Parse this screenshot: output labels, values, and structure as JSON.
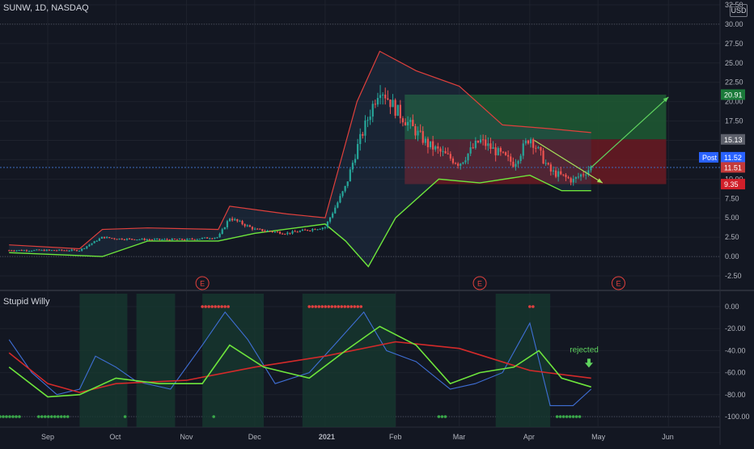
{
  "header": {
    "symbol_line": "SUNW, 1D, NASDAQ",
    "currency": "USD",
    "indicator_title": "Stupid Willy"
  },
  "colors": {
    "background": "#131722",
    "up_candle": "#26a69a",
    "down_candle": "#ef5350",
    "upper_band": "#e0403c",
    "lower_band": "#6ee63c",
    "profit_zone": "#1e5a32",
    "loss_zone": "#6b1a22",
    "projection_arrow": "#5fd35f",
    "indicator_blue": "#3f6fd6",
    "indicator_red": "#d42a2a",
    "indicator_green": "#6ee63c",
    "highlight_teal": "#16382f"
  },
  "price_labels": {
    "target": "20.91",
    "entry": "15.13",
    "post_label": "Post",
    "post_price": "11.52",
    "last_price": "11.51",
    "stop": "9.35"
  },
  "annotation": {
    "rejected": "rejected",
    "earnings_marker": "E"
  },
  "chart_data": [
    {
      "type": "candlestick",
      "title": "SUNW, 1D, NASDAQ",
      "y_ticks": [
        "32.50",
        "30.00",
        "27.50",
        "25.00",
        "22.50",
        "20.00",
        "17.50",
        "15.00",
        "12.50",
        "10.00",
        "7.50",
        "5.00",
        "2.50",
        "0.00",
        "-2.50"
      ],
      "ylim": [
        -3.5,
        32.5
      ],
      "x_ticks": [
        "Sep",
        "Oct",
        "Nov",
        "Dec",
        "2021",
        "Feb",
        "Mar",
        "Apr",
        "May",
        "Jun"
      ],
      "price_path": {
        "x": [
          "2020-08-15",
          "2020-09-01",
          "2020-09-15",
          "2020-09-25",
          "2020-10-01",
          "2020-10-15",
          "2020-11-01",
          "2020-11-15",
          "2020-11-20",
          "2020-12-01",
          "2020-12-15",
          "2021-01-01",
          "2021-01-10",
          "2021-01-15",
          "2021-01-25",
          "2021-02-01",
          "2021-02-15",
          "2021-03-01",
          "2021-03-10",
          "2021-03-25",
          "2021-04-01",
          "2021-04-10",
          "2021-04-20",
          "2021-04-28"
        ],
        "y": [
          0.8,
          0.8,
          0.8,
          2.5,
          2.3,
          2.2,
          2.2,
          2.5,
          5.0,
          3.5,
          3.0,
          3.8,
          9.0,
          14.0,
          22.0,
          19.0,
          14.5,
          12.0,
          15.0,
          12.0,
          15.5,
          11.0,
          9.8,
          11.5
        ]
      },
      "upper_band": {
        "x": [
          "2020-08-15",
          "2020-09-15",
          "2020-09-25",
          "2020-10-15",
          "2020-11-15",
          "2020-11-20",
          "2020-12-15",
          "2021-01-01",
          "2021-01-15",
          "2021-01-25",
          "2021-02-10",
          "2021-03-01",
          "2021-03-20",
          "2021-04-10",
          "2021-04-28"
        ],
        "y": [
          1.5,
          1.0,
          3.5,
          3.7,
          3.5,
          6.5,
          5.5,
          5.0,
          20.0,
          26.5,
          24.0,
          22.0,
          17.0,
          16.5,
          16.0
        ]
      },
      "lower_band": {
        "x": [
          "2020-08-15",
          "2020-09-25",
          "2020-10-15",
          "2020-11-15",
          "2020-12-01",
          "2021-01-01",
          "2021-01-10",
          "2021-01-20",
          "2021-02-01",
          "2021-02-20",
          "2021-03-10",
          "2021-04-01",
          "2021-04-15",
          "2021-04-28"
        ],
        "y": [
          0.5,
          0.0,
          2.0,
          2.0,
          3.0,
          4.2,
          2.0,
          -1.3,
          5.0,
          10.0,
          9.5,
          10.5,
          8.5,
          8.5
        ]
      },
      "trade_zones": {
        "profit": {
          "from": "2021-02-05",
          "to": "2021-05-31",
          "low": 15.13,
          "high": 20.91
        },
        "loss": {
          "from": "2021-02-05",
          "to": "2021-05-31",
          "low": 9.35,
          "high": 15.13
        }
      },
      "earnings_dates": [
        "2020-11-08",
        "2021-03-10",
        "2021-05-10"
      ]
    },
    {
      "type": "line",
      "title": "Stupid Willy",
      "y_ticks": [
        "0.00",
        "-20.00",
        "-40.00",
        "-60.00",
        "-80.00",
        "-100.00"
      ],
      "ylim": [
        -105,
        5
      ],
      "x_ticks": [
        "Sep",
        "Oct",
        "Nov",
        "Dec",
        "2021",
        "Feb",
        "Mar",
        "Apr",
        "May",
        "Jun"
      ],
      "series": [
        {
          "x": [
            "2020-08-15",
            "2020-08-25",
            "2020-09-05",
            "2020-09-15",
            "2020-09-22",
            "2020-10-01",
            "2020-10-10",
            "2020-10-25",
            "2020-11-08",
            "2020-11-18",
            "2020-11-28",
            "2020-12-10",
            "2020-12-25",
            "2021-01-05",
            "2021-01-18",
            "2021-01-28",
            "2021-02-10",
            "2021-02-25",
            "2021-03-08",
            "2021-03-20",
            "2021-04-01",
            "2021-04-10",
            "2021-04-20",
            "2021-04-28"
          ],
          "y": [
            -30,
            -60,
            -80,
            -75,
            -45,
            -55,
            -68,
            -75,
            -35,
            -5,
            -30,
            -70,
            -60,
            -35,
            -5,
            -40,
            -50,
            -75,
            -70,
            -60,
            -15,
            -90,
            -90,
            -75
          ]
        },
        {
          "x": [
            "2020-08-15",
            "2020-09-01",
            "2020-09-15",
            "2020-10-01",
            "2020-11-01",
            "2020-12-01",
            "2021-01-01",
            "2021-02-01",
            "2021-03-01",
            "2021-04-01",
            "2021-04-28"
          ],
          "y": [
            -42,
            -70,
            -78,
            -70,
            -67,
            -55,
            -45,
            -32,
            -38,
            -58,
            -65
          ]
        },
        {
          "x": [
            "2020-08-15",
            "2020-09-01",
            "2020-09-15",
            "2020-10-01",
            "2020-10-20",
            "2020-11-08",
            "2020-11-20",
            "2020-12-05",
            "2020-12-25",
            "2021-01-10",
            "2021-01-25",
            "2021-02-10",
            "2021-02-25",
            "2021-03-10",
            "2021-03-25",
            "2021-04-05",
            "2021-04-15",
            "2021-04-28"
          ],
          "y": [
            -55,
            -82,
            -80,
            -65,
            -70,
            -70,
            -35,
            -55,
            -65,
            -40,
            -18,
            -35,
            -70,
            -60,
            -55,
            -40,
            -65,
            -73
          ]
        }
      ]
    }
  ]
}
